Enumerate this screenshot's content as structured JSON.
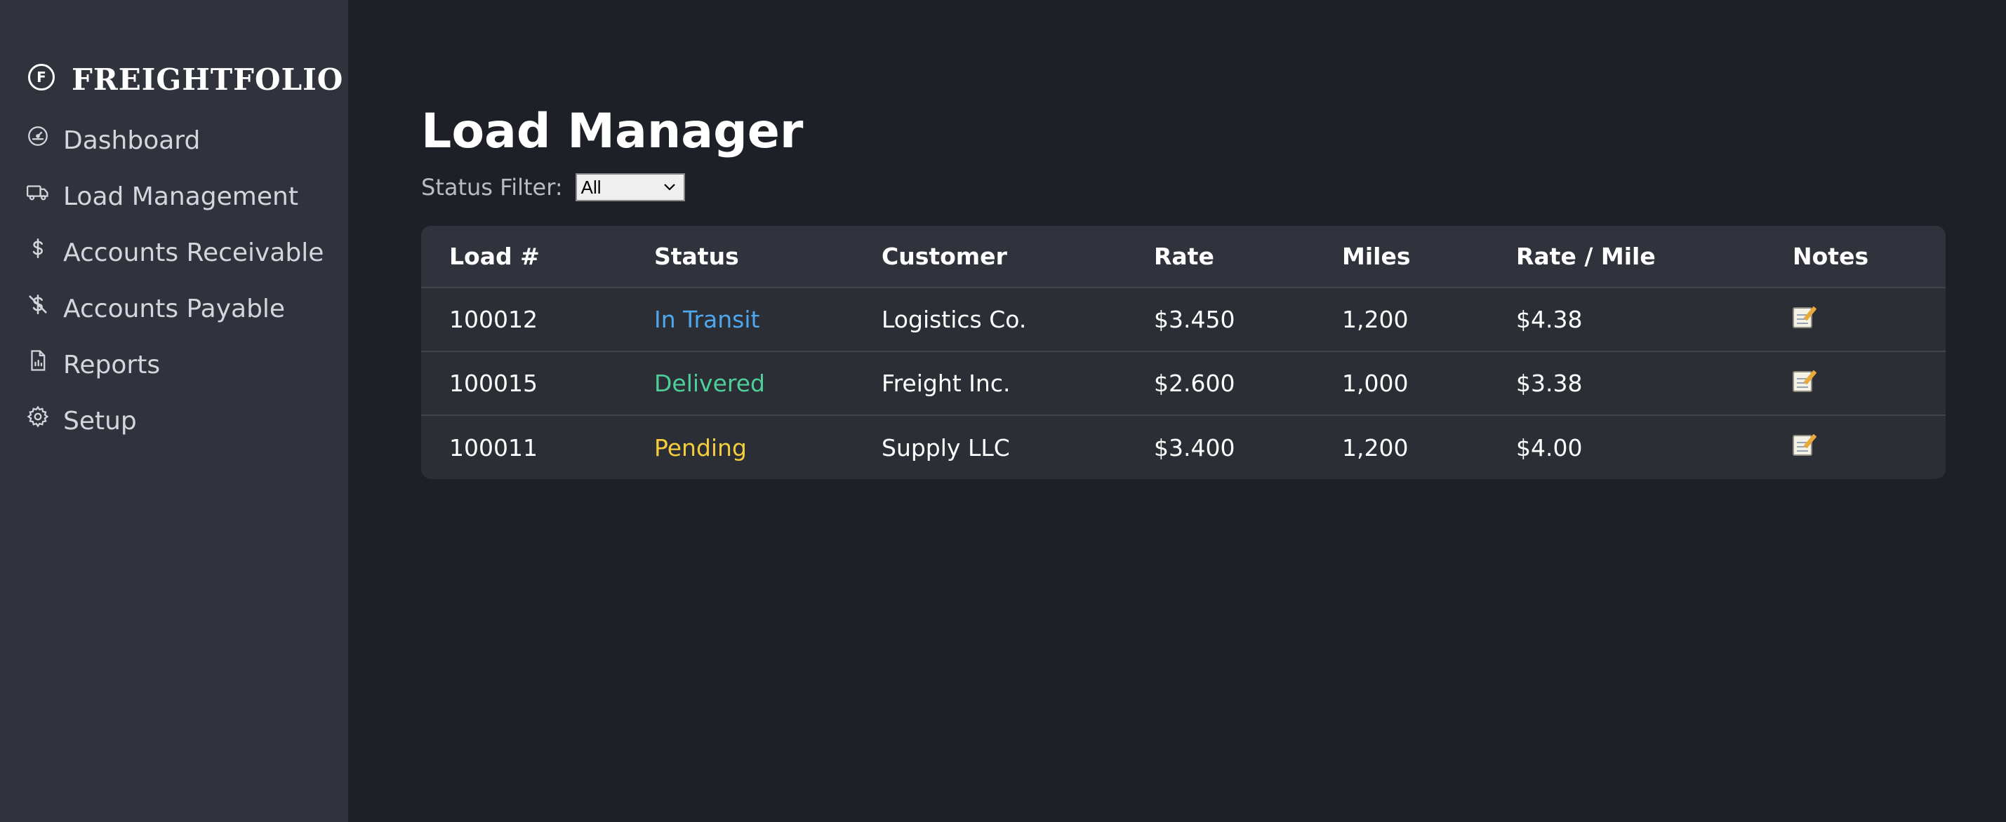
{
  "brand": {
    "name": "FREIGHTFOLIO",
    "icon_letter": "F"
  },
  "sidebar": {
    "items": [
      {
        "label": "Dashboard",
        "icon": "speedometer-icon"
      },
      {
        "label": "Load Management",
        "icon": "truck-icon"
      },
      {
        "label": "Accounts Receivable",
        "icon": "dollar-icon"
      },
      {
        "label": "Accounts Payable",
        "icon": "dollar-slash-icon"
      },
      {
        "label": "Reports",
        "icon": "report-icon"
      },
      {
        "label": "Setup",
        "icon": "gear-icon"
      }
    ]
  },
  "main": {
    "title": "Load Manager",
    "filter": {
      "label": "Status Filter:",
      "selected": "All"
    },
    "table": {
      "headers": [
        "Load #",
        "Status",
        "Customer",
        "Rate",
        "Miles",
        "Rate / Mile",
        "Notes"
      ],
      "rows": [
        {
          "load": "100012",
          "status": "In Transit",
          "status_color": "#4ea8f0",
          "customer": "Logistics Co.",
          "rate": "$3.450",
          "miles": "1,200",
          "rate_mile": "$4.38"
        },
        {
          "load": "100015",
          "status": "Delivered",
          "status_color": "#4ecf9a",
          "customer": "Freight Inc.",
          "rate": "$2.600",
          "miles": "1,000",
          "rate_mile": "$3.38"
        },
        {
          "load": "100011",
          "status": "Pending",
          "status_color": "#f5cd3c",
          "customer": "Supply LLC",
          "rate": "$3.400",
          "miles": "1,200",
          "rate_mile": "$4.00"
        }
      ]
    }
  }
}
